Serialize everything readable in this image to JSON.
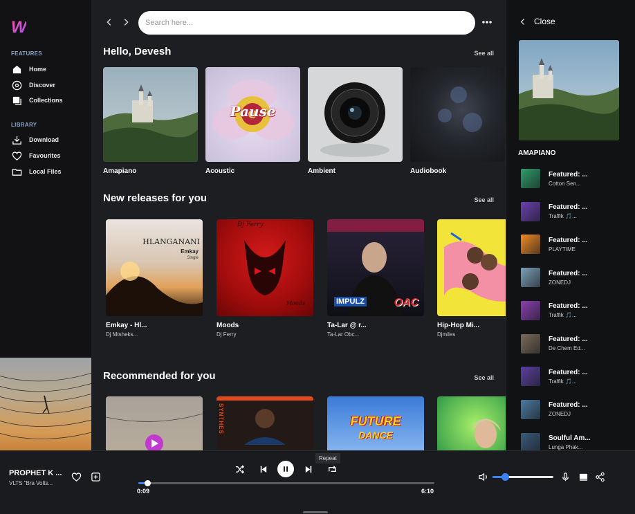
{
  "sidebar": {
    "logo": "W",
    "features_title": "FEATURES",
    "library_title": "LIBRARY",
    "features": [
      {
        "label": "Home",
        "icon": "home-icon"
      },
      {
        "label": "Discover",
        "icon": "compass-icon"
      },
      {
        "label": "Collections",
        "icon": "collections-icon"
      }
    ],
    "library": [
      {
        "label": "Download",
        "icon": "download-icon"
      },
      {
        "label": "Favourites",
        "icon": "heart-icon"
      },
      {
        "label": "Local Files",
        "icon": "folder-icon"
      }
    ]
  },
  "search": {
    "placeholder": "Search here..."
  },
  "main": {
    "greeting": "Hello, Devesh",
    "see_all": "See all",
    "genres": [
      {
        "label": "Amapiano"
      },
      {
        "label": "Acoustic",
        "art_text": "Pause"
      },
      {
        "label": "Ambient"
      },
      {
        "label": "Audiobook"
      }
    ],
    "new_releases_title": "New releases for you",
    "new_releases": [
      {
        "title": "Emkay - Hl...",
        "artist": "Dj Mtsheks...",
        "art_text_1": "HLANGANANI",
        "art_text_2": "Emkay",
        "art_text_3": "Single"
      },
      {
        "title": "Moods",
        "artist": "Dj Ferry",
        "art_text_1": "Dj Ferry",
        "art_text_2": "Moods"
      },
      {
        "title": "Ta-Lar @ r...",
        "artist": "Ta-Lar Obc...",
        "art_text_1": "IMPULZ",
        "art_text_2": "OAC"
      },
      {
        "title": "Hip-Hop Mi...",
        "artist": "Djmiles"
      }
    ],
    "recommended_title": "Recommended for you",
    "recommended_art_text": [
      "SYNTHES",
      "FUTURE",
      "DANCE"
    ]
  },
  "right_panel": {
    "close_label": "Close",
    "playlist_title": "AMAPIANO",
    "items": [
      {
        "title": "Featured: ...",
        "artist": "Cotton Sen...",
        "color": "#2e9d6a"
      },
      {
        "title": "Featured: ...",
        "artist": "Traffik 🎵...",
        "color": "#6a3fb0"
      },
      {
        "title": "Featured: ...",
        "artist": "PLAYTIME",
        "color": "#f08a24"
      },
      {
        "title": "Featured: ...",
        "artist": "ZONEDJ",
        "color": "#7aa0b8"
      },
      {
        "title": "Featured: ...",
        "artist": "Traffik 🎵...",
        "color": "#8a3fb0"
      },
      {
        "title": "Featured: ...",
        "artist": "De Chem Ed...",
        "color": "#7a6a5a"
      },
      {
        "title": "Featured: ...",
        "artist": "Traffik 🎵...",
        "color": "#5a3fa0"
      },
      {
        "title": "Featured: ...",
        "artist": "ZONEDJ",
        "color": "#4a7aa0"
      },
      {
        "title": "Soulful Am...",
        "artist": "Lunga Phak...",
        "color": "#3a5a7a"
      }
    ]
  },
  "player": {
    "title": "PROPHET K ...",
    "artist": "VLTS \"Bra Volts...",
    "elapsed": "0:09",
    "duration": "6:10",
    "progress": 0.03,
    "volume": 0.2,
    "tooltip": "Repeat",
    "accent": "#3b82f6"
  }
}
